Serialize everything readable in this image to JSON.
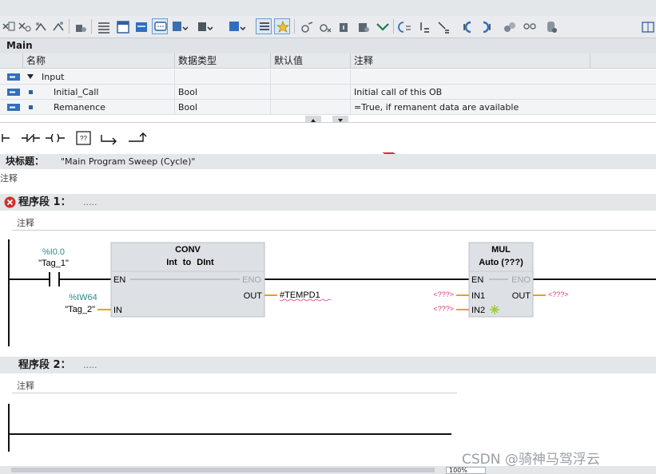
{
  "interface": {
    "title": "Main",
    "columns": [
      "名称",
      "数据类型",
      "默认值",
      "注释"
    ],
    "rows": [
      {
        "name": "Input",
        "type": "",
        "default": "",
        "comment": ""
      },
      {
        "name": "Initial_Call",
        "type": "Bool",
        "default": "",
        "comment": "Initial call of this OB"
      },
      {
        "name": "Remanence",
        "type": "Bool",
        "default": "",
        "comment": "=True, if remanent data are available"
      }
    ]
  },
  "block": {
    "title_label": "块标题：",
    "title_value": "\"Main Program Sweep (Cycle)\"",
    "comment": "注释"
  },
  "networks": [
    {
      "label": "程序段 1：",
      "dots": ".....",
      "comment": "注释",
      "has_error": true
    },
    {
      "label": "程序段 2：",
      "dots": ".....",
      "comment": "注释",
      "has_error": false
    }
  ],
  "ladder": {
    "contact_address": "%I0.0",
    "contact_tag": "\"Tag_1\"",
    "conv": {
      "name": "CONV",
      "from_type": "Int",
      "to_word": "to",
      "to_type": "DInt",
      "en": "EN",
      "eno": "ENO",
      "in_pin": "IN",
      "out_pin": "OUT",
      "in_address": "%IW64",
      "in_tag": "\"Tag_2\"",
      "out_operand": "#TEMPD1"
    },
    "mul": {
      "name": "MUL",
      "mode": "Auto (???)",
      "en": "EN",
      "eno": "ENO",
      "in1": "IN1",
      "in2": "IN2",
      "out_pin": "OUT",
      "in1_operand": "<???>",
      "in2_operand": "<???>",
      "out_operand": "<???>"
    }
  },
  "zoom_value": "100%",
  "watermark": "CSDN @骑神马驾浮云",
  "colors": {
    "accent": "#e8a020",
    "address": "#2a8a8a",
    "missing": "#e0307a",
    "error": "#d0302c",
    "arrow": "#e3262b"
  }
}
